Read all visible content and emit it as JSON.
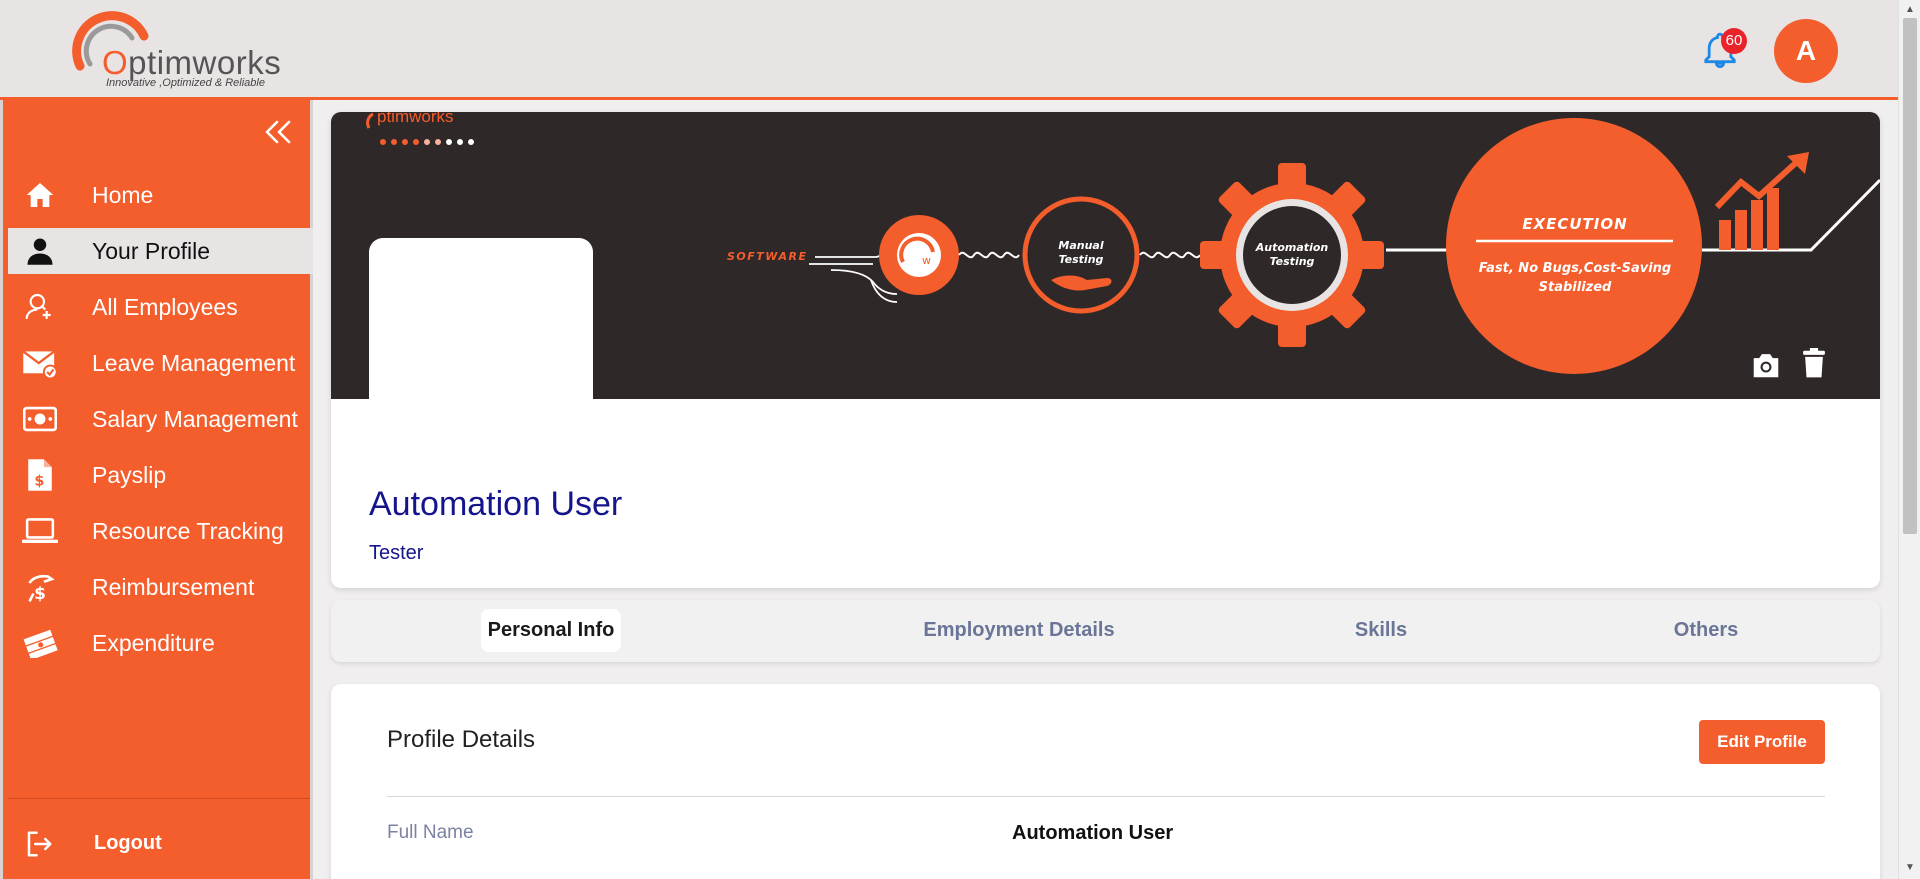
{
  "header": {
    "logo_name_prefix": "O",
    "logo_name_rest": "ptimworks",
    "logo_tagline": "Innovative ,Optimized & Reliable",
    "notification_count": "60",
    "avatar_initial": "A"
  },
  "sidebar": {
    "items": [
      {
        "label": "Home",
        "icon": "home-icon"
      },
      {
        "label": "Your Profile",
        "icon": "user-icon",
        "active": true
      },
      {
        "label": "All Employees",
        "icon": "employees-icon"
      },
      {
        "label": "Leave Management",
        "icon": "mail-check-icon"
      },
      {
        "label": "Salary Management",
        "icon": "money-icon"
      },
      {
        "label": "Payslip",
        "icon": "payslip-icon"
      },
      {
        "label": "Resource Tracking",
        "icon": "laptop-icon"
      },
      {
        "label": "Reimbursement",
        "icon": "reimbursement-icon"
      },
      {
        "label": "Expenditure",
        "icon": "cash-stack-icon"
      }
    ],
    "logout_label": "Logout"
  },
  "banner": {
    "brand_partial": "ptimworks",
    "software_label": "SOFTWARE",
    "manual_label_1": "Manual",
    "manual_label_2": "Testing",
    "automation_label_1": "Automation",
    "automation_label_2": "Testing",
    "execution_title": "EXECUTION",
    "execution_line_1": "Fast, No Bugs,Cost-Saving",
    "execution_line_2": "Stabilized"
  },
  "profile": {
    "name": "Automation User",
    "role": "Tester"
  },
  "tabs": [
    "Personal Info",
    "Employment Details",
    "Skills",
    "Others"
  ],
  "details": {
    "title": "Profile Details",
    "edit_button": "Edit Profile",
    "fields": [
      {
        "label": "Full Name",
        "value": "Automation User"
      }
    ]
  },
  "colors": {
    "brand_orange": "#f45d2c",
    "banner_dark": "#2f2828",
    "name_blue": "#14148c"
  }
}
